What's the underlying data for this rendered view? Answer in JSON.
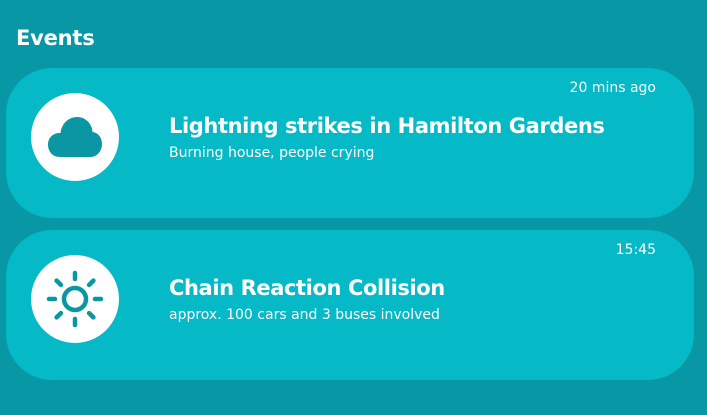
{
  "section": {
    "title": "Events"
  },
  "events": [
    {
      "icon": "cloud-icon",
      "time": "20 mins ago",
      "title": "Lightning strikes in Hamilton Gardens",
      "description": "Burning house, people crying"
    },
    {
      "icon": "sun-icon",
      "time": "15:45",
      "title": "Chain Reaction Collision",
      "description": "approx. 100 cars and 3 buses involved"
    }
  ],
  "colors": {
    "background": "#0898a5",
    "card": "#05b9c7",
    "icon_fill": "#0a97a3",
    "text": "#ffffff"
  }
}
